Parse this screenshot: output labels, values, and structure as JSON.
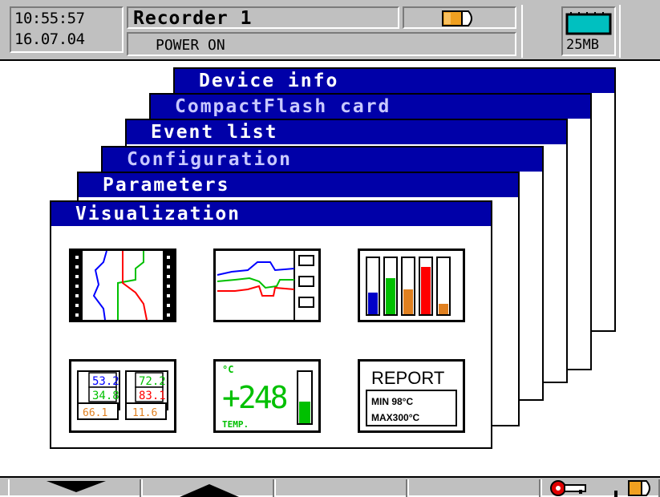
{
  "status_bar": {
    "time": "10:55:57",
    "date": "16.07.04",
    "recorder_name": "Recorder 1",
    "status_text": "POWER ON",
    "card_capacity": "25MB",
    "icons": [
      "power-plug-icon",
      "memory-card-icon"
    ]
  },
  "windows": [
    {
      "title": "Device info"
    },
    {
      "title": "CompactFlash card"
    },
    {
      "title": "Event list"
    },
    {
      "title": "Configuration"
    },
    {
      "title": "Parameters"
    },
    {
      "title": "Visualization"
    }
  ],
  "visualization_tiles": {
    "digital": {
      "values": [
        "53.2",
        "72.2",
        "34.8",
        "83.1",
        "66.1",
        "11.6"
      ]
    },
    "big_value": {
      "unit": "°C",
      "value": "+248",
      "label": "TEMP."
    },
    "report": {
      "title": "REPORT",
      "min": "MIN 98°C",
      "max": "MAX300°C"
    }
  },
  "bottom_bar": {
    "icons": [
      "arrow-down-icon",
      "arrow-up-icon",
      "key-icon",
      "power-plug-icon"
    ]
  },
  "colors": {
    "title_bar": "#0000a8",
    "panel_gray": "#c0c0c0",
    "trace_blue": "#0000ff",
    "trace_green": "#00c000",
    "trace_red": "#ff0000",
    "trace_orange": "#e08020"
  }
}
